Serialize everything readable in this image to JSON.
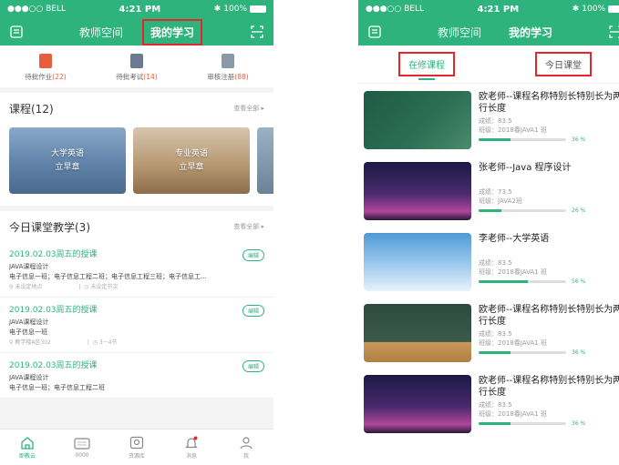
{
  "colors": {
    "accent": "#2eb37d",
    "highlight_box": "#e0282f",
    "count": "#e85d3c"
  },
  "left": {
    "status": {
      "carrier": "●●●○○ BELL",
      "time": "4:21 PM",
      "battery": "100%"
    },
    "nav": {
      "tab_space": "教师空间",
      "tab_study": "我的学习"
    },
    "quick": [
      {
        "label": "待批作业",
        "count": "(22)",
        "icon": "homework-icon",
        "color": "#e85d3c"
      },
      {
        "label": "待批考试",
        "count": "(14)",
        "icon": "exam-icon",
        "color": "#6b7a8f"
      },
      {
        "label": "审核注册",
        "count": "(88)",
        "icon": "register-icon",
        "color": "#8a98a8"
      }
    ],
    "courses": {
      "title": "课程(12)",
      "see_all": "查看全部 ▸",
      "cards": [
        {
          "name": "大学英语",
          "author": "立早章"
        },
        {
          "name": "专业英语",
          "author": "立早章"
        }
      ]
    },
    "today": {
      "title": "今日课堂教学(3)",
      "see_all": "查看全部 ▸",
      "lessons": [
        {
          "title": "2019.02.03周五的授课",
          "course": "JAVA课程设计",
          "classes": "电子信息一班；电子信息工程二班；电子信息工程三班；电子信息工...",
          "location": "未设定地点",
          "period": "未设定节次",
          "edit": "编辑"
        },
        {
          "title": "2019.02.03周五的授课",
          "course": "JAVA课程设计",
          "classes": "电子信息一班",
          "location": "教学楼A区302",
          "period": "3－4节",
          "edit": "编辑"
        },
        {
          "title": "2019.02.03周五的授课",
          "course": "JAVA课程设计",
          "classes": "电子信息一班；电子信息工程二班",
          "location": "",
          "period": "",
          "edit": "编辑"
        }
      ]
    },
    "bottom_nav": [
      {
        "label": "即教云",
        "icon": "home-icon"
      },
      {
        "label": "0000",
        "icon": "keyboard-icon"
      },
      {
        "label": "资源库",
        "icon": "resource-icon"
      },
      {
        "label": "消息",
        "icon": "bell-icon"
      },
      {
        "label": "我",
        "icon": "user-icon"
      }
    ]
  },
  "right": {
    "status": {
      "carrier": "●●●○○ BELL",
      "time": "4:21 PM",
      "battery": "100%"
    },
    "nav": {
      "tab_space": "教师空间",
      "tab_study": "我的学习"
    },
    "subtabs": {
      "current": "在修课程",
      "today": "今日课堂"
    },
    "courses": [
      {
        "title": "欧老师--课程名称特别长特别长为两行长度",
        "score": "成绩：83.5",
        "class": "班级：2018春JAVA1 班",
        "progress": 36,
        "progress_text": "36 %",
        "thumb": "green"
      },
      {
        "title": "张老师--Java 程序设计",
        "score": "成绩：73.5",
        "class": "班级：JAVA2班",
        "progress": 26,
        "progress_text": "26 %",
        "thumb": "purple"
      },
      {
        "title": "李老师--大学英语",
        "score": "成绩：83.5",
        "class": "班级：2018春JAVA1 班",
        "progress": 56,
        "progress_text": "56 %",
        "thumb": "sky"
      },
      {
        "title": "欧老师--课程名称特别长特别长为两行长度",
        "score": "成绩：83.5",
        "class": "班级：2018春JAVA1 班",
        "progress": 36,
        "progress_text": "36 %",
        "thumb": "board"
      },
      {
        "title": "欧老师--课程名称特别长特别长为两行长度",
        "score": "成绩：83.5",
        "class": "班级：2018春JAVA1 班",
        "progress": 36,
        "progress_text": "36 %",
        "thumb": "purple"
      }
    ]
  }
}
